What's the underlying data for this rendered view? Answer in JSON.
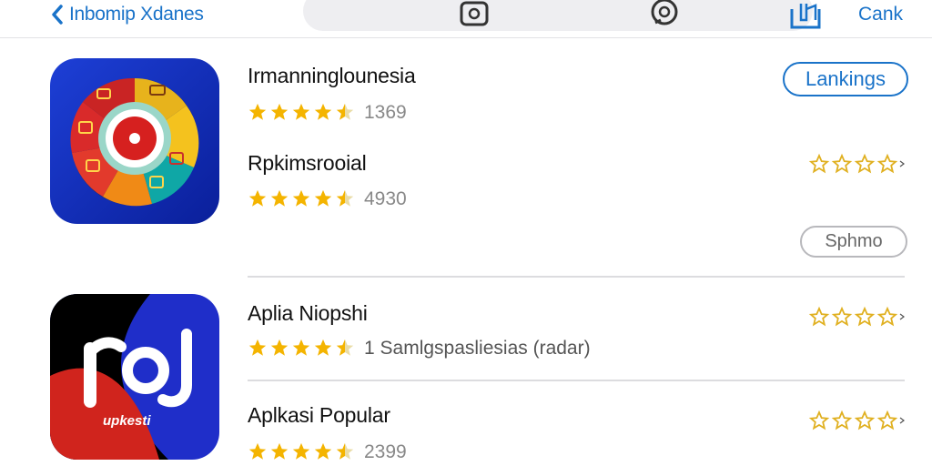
{
  "header": {
    "back_label": "Inbomip Xdanes",
    "cancel_label": "Cank"
  },
  "apps": [
    {
      "title": "Irmanninglounesia",
      "rating": 4.5,
      "count": "1369",
      "button": "Lankings"
    },
    {
      "title": "Rpkimsrooial",
      "rating": 4.5,
      "count": "4930",
      "button": "Sphmo"
    },
    {
      "title": "Aplia Niopshi",
      "rating": 4.5,
      "count": "1 Samlgspasliesias (radar)",
      "icon_text": "upkesti"
    },
    {
      "title": "Aplkasi Popular",
      "rating": 4.5,
      "count": "2399"
    }
  ],
  "colors": {
    "accent": "#1a73c9",
    "star": "#f4b400",
    "divider": "#dcdcdf"
  }
}
